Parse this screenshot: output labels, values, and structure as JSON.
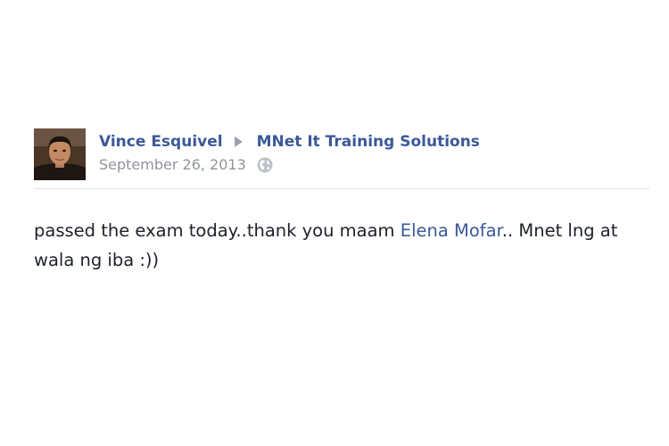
{
  "post": {
    "author": "Vince Esquivel",
    "target": "MNet It Training Solutions",
    "timestamp": "September 26, 2013",
    "privacy_icon": "globe-icon",
    "arrow_icon": "right-triangle-icon",
    "body": {
      "text_before": "passed the exam today..thank you maam ",
      "mention": "Elena Mofar",
      "text_after": ".. Mnet lng at wala ng iba :))"
    }
  },
  "colors": {
    "link": "#3b5998",
    "meta": "#90949c",
    "text": "#1d2129",
    "divider": "#e2e4e8"
  }
}
